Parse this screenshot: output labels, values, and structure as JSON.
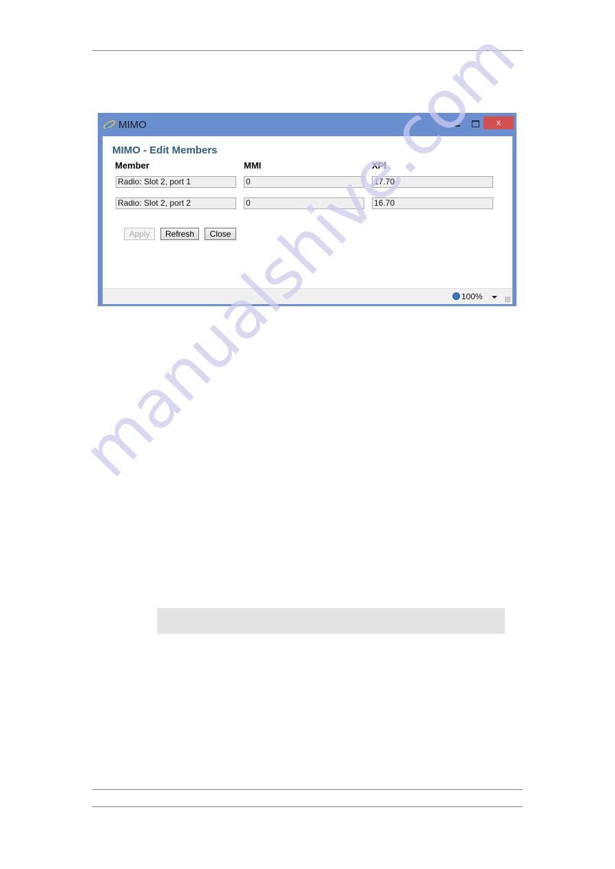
{
  "window": {
    "title": "MIMO",
    "controls": {
      "minimize": "minimize",
      "maximize": "maximize",
      "close": "x"
    }
  },
  "dialog": {
    "heading": "MIMO - Edit Members",
    "columns": [
      "Member",
      "MMI",
      "XPI"
    ],
    "rows": [
      {
        "member": "Radio: Slot 2, port 1",
        "mmi": "0",
        "xpi": "17.70"
      },
      {
        "member": "Radio: Slot 2, port 2",
        "mmi": "0",
        "xpi": "16.70"
      }
    ],
    "buttons": {
      "apply": "Apply",
      "refresh": "Refresh",
      "close": "Close"
    }
  },
  "statusbar": {
    "zoom": "100%"
  },
  "watermark": "manualshive.com",
  "colors": {
    "titlebar": "#6a8fd0",
    "close_button": "#d35050",
    "heading": "#2b5f80"
  }
}
